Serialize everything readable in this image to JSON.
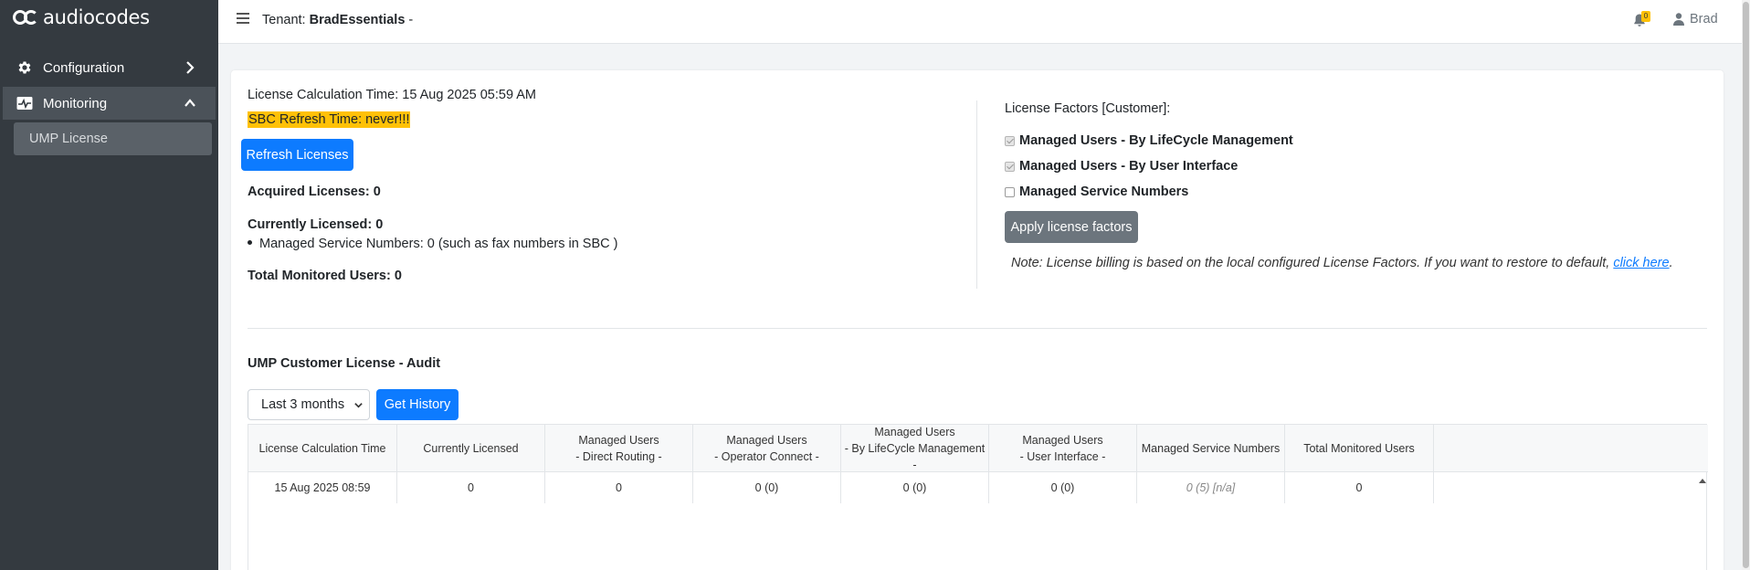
{
  "brand": {
    "logo_text": "audiocodes"
  },
  "sidebar": {
    "items": [
      {
        "label": "Configuration",
        "icon": "gear-icon",
        "chevron": "chevron-right-icon"
      },
      {
        "label": "Monitoring",
        "icon": "monitor-chart-icon",
        "chevron": "chevron-up-icon"
      }
    ],
    "sub_items": [
      {
        "label": "UMP License"
      }
    ]
  },
  "topbar": {
    "tenant_label": "Tenant:",
    "tenant_name": "BradEssentials",
    "tenant_suffix": "-",
    "notifications_count": "0",
    "user_name": "Brad"
  },
  "license": {
    "calc_time": "License Calculation Time: 15 Aug 2025 05:59 AM",
    "sbc_refresh": "SBC Refresh Time: never!!!",
    "refresh_button": "Refresh Licenses",
    "acquired": "Acquired Licenses: 0",
    "currently_licensed": "Currently Licensed: 0",
    "managed_service_numbers": "Managed Service Numbers: 0 (such as fax numbers in SBC )",
    "total_monitored": "Total Monitored Users: 0"
  },
  "factors": {
    "title": "License Factors [Customer]:",
    "options": [
      {
        "label": "Managed Users - By LifeCycle Management",
        "checked": true,
        "disabled": true
      },
      {
        "label": "Managed Users - By User Interface",
        "checked": true,
        "disabled": true
      },
      {
        "label": "Managed Service Numbers",
        "checked": false,
        "disabled": false
      }
    ],
    "apply_button": "Apply license factors",
    "note_text": "Note: License billing is based on the local configured License Factors. If you want to restore to default,",
    "note_link": "click here",
    "note_end": "."
  },
  "audit": {
    "title": "UMP Customer License - Audit",
    "period_selected": "Last 3 months",
    "history_button": "Get History",
    "columns": [
      [
        "License Calculation Time"
      ],
      [
        "Currently Licensed"
      ],
      [
        "Managed Users",
        "- Direct Routing -"
      ],
      [
        "Managed Users",
        "- Operator Connect -"
      ],
      [
        "Managed Users",
        "- By LifeCycle Management -"
      ],
      [
        "Managed Users",
        "- User Interface -"
      ],
      [
        "Managed Service Numbers"
      ],
      [
        "Total Monitored Users"
      ]
    ],
    "rows": [
      [
        "15 Aug 2025 08:59",
        "0",
        "0",
        "0 (0)",
        "0 (0)",
        "0 (0)",
        "0 (5) [n/a]",
        "0"
      ]
    ]
  },
  "colors": {
    "sidebar_bg": "#343a40",
    "primary": "#0d7bff",
    "secondary": "#6c757d",
    "highlight": "#ffc107"
  }
}
